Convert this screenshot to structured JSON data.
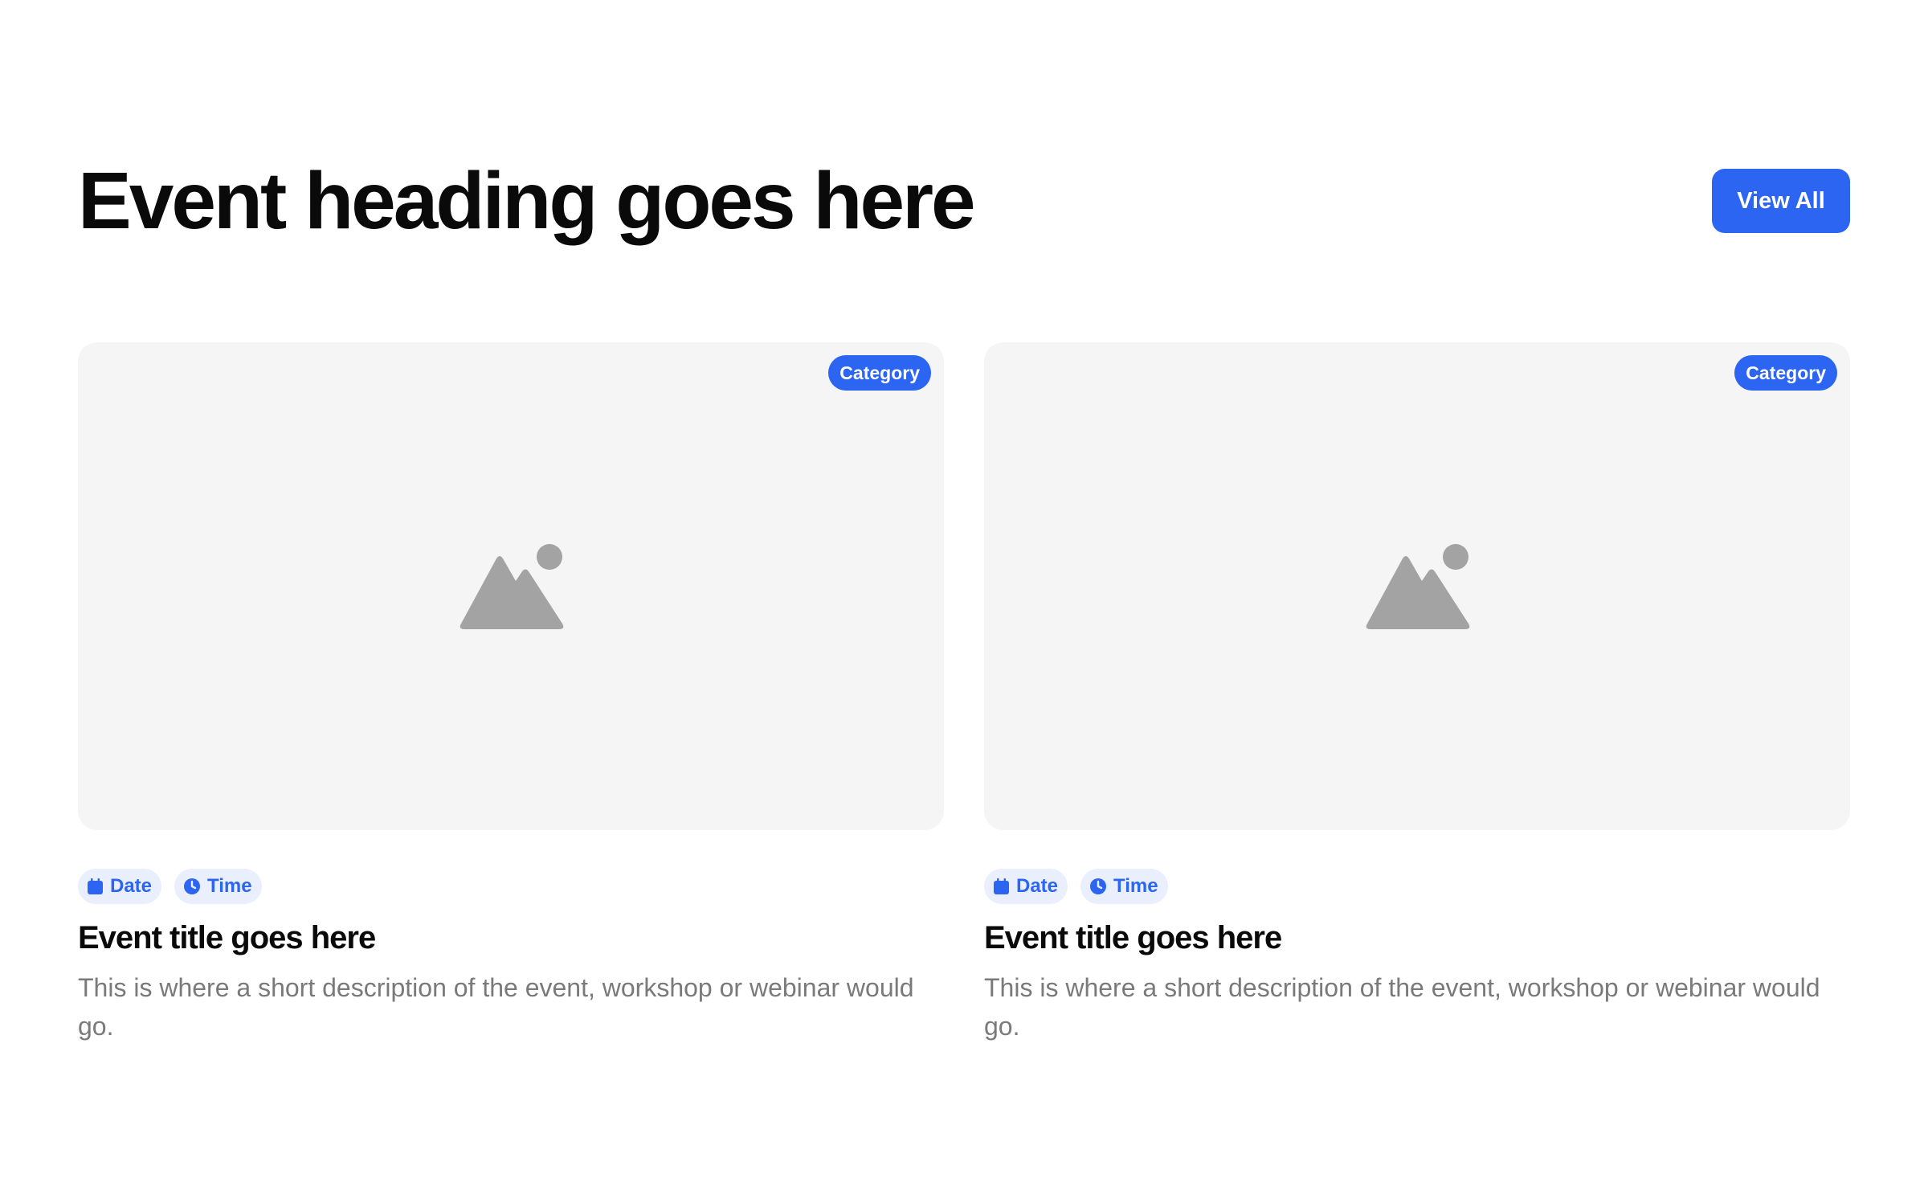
{
  "header": {
    "title": "Event heading goes here",
    "view_all_label": "View All"
  },
  "cards": [
    {
      "category": "Category",
      "image_icon": "image-placeholder-icon",
      "date_label": "Date",
      "time_label": "Time",
      "title": "Event title goes here",
      "description": "This is where a short description of the event, workshop or webinar would go."
    },
    {
      "category": "Category",
      "image_icon": "image-placeholder-icon",
      "date_label": "Date",
      "time_label": "Time",
      "title": "Event title goes here",
      "description": "This is where a short description of the event, workshop or webinar would go."
    }
  ],
  "icons": {
    "date": "calendar-icon",
    "time": "clock-icon"
  },
  "colors": {
    "accent": "#2b65f2",
    "tag_background": "#e9effc",
    "image_placeholder": "#f5f5f5",
    "placeholder_icon": "#a3a3a3",
    "heading_text": "#0a0a0a",
    "body_text": "#7a7a7a"
  }
}
